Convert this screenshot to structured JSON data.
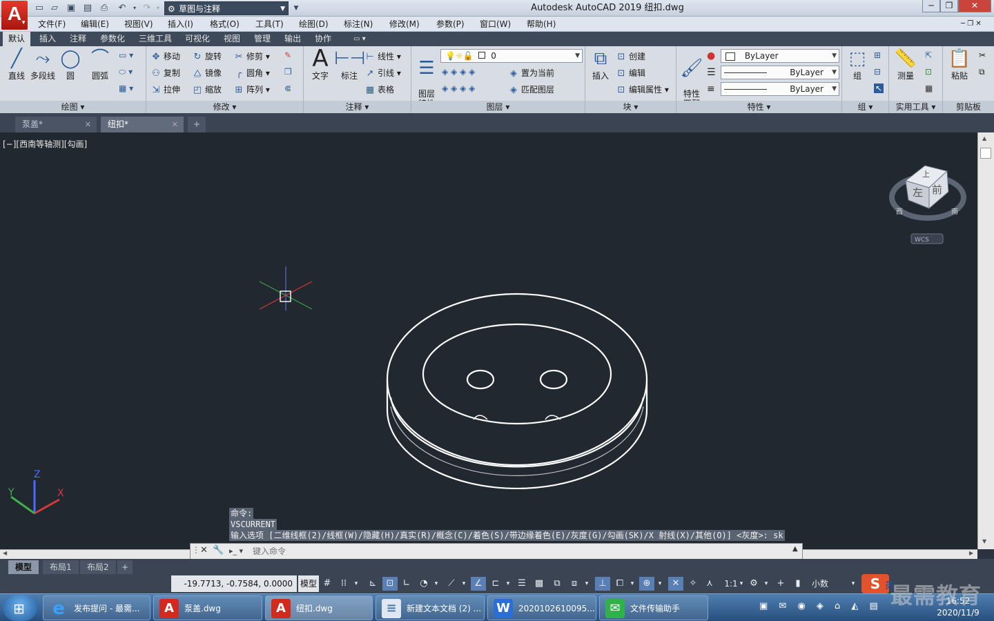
{
  "titlebar": {
    "title": "Autodesk AutoCAD 2019    纽扣.dwg",
    "workspace": "草图与注释",
    "logo": "A",
    "minimize": "─",
    "restore": "❐",
    "close": "✕"
  },
  "menu": [
    "文件(F)",
    "编辑(E)",
    "视图(V)",
    "插入(I)",
    "格式(O)",
    "工具(T)",
    "绘图(D)",
    "标注(N)",
    "修改(M)",
    "参数(P)",
    "窗口(W)",
    "帮助(H)"
  ],
  "ribbon_tabs": [
    "默认",
    "插入",
    "注释",
    "参数化",
    "三维工具",
    "可视化",
    "视图",
    "管理",
    "输出",
    "协作"
  ],
  "panels": {
    "draw": {
      "title": "绘图 ▾",
      "line": "直线",
      "polyline": "多段线",
      "circle": "圆",
      "arc": "圆弧"
    },
    "modify": {
      "title": "修改 ▾",
      "move": "移动",
      "rotate": "旋转",
      "trim": "修剪",
      "copy": "复制",
      "mirror": "镜像",
      "fillet": "圆角",
      "stretch": "拉伸",
      "scale": "缩放",
      "array": "阵列"
    },
    "annotation": {
      "title": "注释 ▾",
      "text": "文字",
      "dimension": "标注",
      "linear": "线性",
      "leader": "引线",
      "table": "表格"
    },
    "layers": {
      "title": "图层 ▾",
      "layer_props": "图层\n特性",
      "current_layer": "0",
      "set_current": "置为当前",
      "match_layer": "匹配图层"
    },
    "block": {
      "title": "块 ▾",
      "insert": "插入",
      "create": "创建",
      "edit": "编辑",
      "edit_attr": "编辑属性"
    },
    "properties": {
      "title": "特性 ▾",
      "match": "特性\n匹配",
      "color": "ByLayer",
      "linetype": "ByLayer",
      "lineweight": "ByLayer"
    },
    "groups": {
      "title": "组 ▾",
      "group": "组"
    },
    "utilities": {
      "title": "实用工具 ▾",
      "measure": "测量"
    },
    "clipboard": {
      "title": "剪贴板",
      "paste": "粘贴"
    }
  },
  "doc_tabs": [
    {
      "label": "泵盖*"
    },
    {
      "label": "纽扣*"
    }
  ],
  "doc_tab_add": "+",
  "viewport": {
    "label": "[−][西南等轴测][勾画]"
  },
  "viewcube": {
    "top": "上",
    "left": "左",
    "front": "前",
    "west": "西",
    "south": "南",
    "wcs": "WCS"
  },
  "ucs": {
    "x": "X",
    "y": "Y",
    "z": "Z"
  },
  "command": {
    "history": [
      "命令:",
      "VSCURRENT",
      "输入选项 [二维线框(2)/线框(W)/隐藏(H)/真实(R)/概念(C)/着色(S)/带边缘着色(E)/灰度(G)/勾画(SK)/X 射线(X)/其他(O)] <灰度>: sk"
    ],
    "placeholder": "键入命令"
  },
  "layout_tabs": [
    "模型",
    "布局1",
    "布局2"
  ],
  "layout_add": "+",
  "status": {
    "coords": "-19.7713, -0.7584, 0.0000",
    "model": "模型",
    "scale": "1:1",
    "units": "小数"
  },
  "taskbar": {
    "items": [
      "发布提问 - 最需...",
      "泵盖.dwg",
      "纽扣.dwg",
      "新建文本文档 (2) ...",
      "2020102610095...",
      "文件传输助手"
    ],
    "ime": "英",
    "time": "16:52",
    "date": "2020/11/9"
  },
  "watermark": "最需教育"
}
